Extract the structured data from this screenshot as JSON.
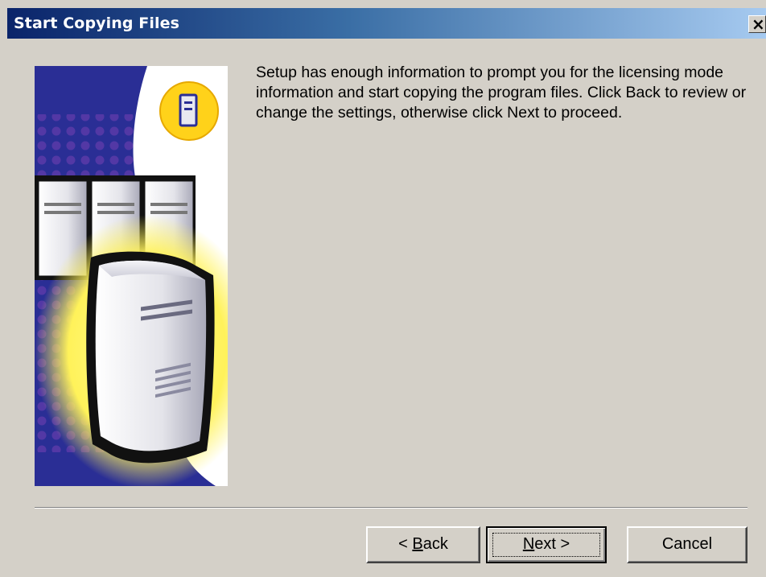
{
  "window": {
    "title": "Start Copying Files",
    "close_glyph": "×"
  },
  "message": "Setup has enough information to prompt you for the licensing mode information and start copying the program files.  Click Back to review or change the settings, otherwise click Next to proceed.",
  "buttons": {
    "back": {
      "prefix": "< ",
      "mnemonic": "B",
      "rest": "ack"
    },
    "next": {
      "mnemonic": "N",
      "rest": "ext >"
    },
    "cancel": "Cancel"
  },
  "illustration": {
    "icons": [
      "server-stack-icon",
      "server-tower-icon",
      "server-badge-icon"
    ],
    "colors": {
      "background_blue": "#2a2e95",
      "dot_purple": "#5a3aa8",
      "glow_yellow": "#fff25a",
      "badge_yellow": "#ffd21a"
    }
  },
  "colors": {
    "dialog_bg": "#d4d0c8",
    "title_start": "#0a246a",
    "title_end": "#a6caf0"
  }
}
